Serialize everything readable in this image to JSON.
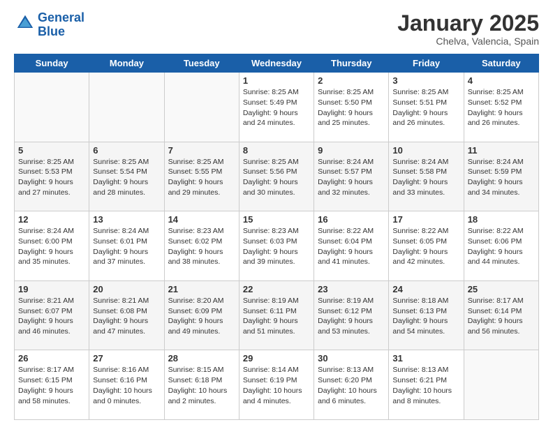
{
  "logo": {
    "line1": "General",
    "line2": "Blue"
  },
  "title": "January 2025",
  "location": "Chelva, Valencia, Spain",
  "weekdays": [
    "Sunday",
    "Monday",
    "Tuesday",
    "Wednesday",
    "Thursday",
    "Friday",
    "Saturday"
  ],
  "weeks": [
    [
      {
        "day": "",
        "sunrise": "",
        "sunset": "",
        "daylight": ""
      },
      {
        "day": "",
        "sunrise": "",
        "sunset": "",
        "daylight": ""
      },
      {
        "day": "",
        "sunrise": "",
        "sunset": "",
        "daylight": ""
      },
      {
        "day": "1",
        "sunrise": "Sunrise: 8:25 AM",
        "sunset": "Sunset: 5:49 PM",
        "daylight": "Daylight: 9 hours and 24 minutes."
      },
      {
        "day": "2",
        "sunrise": "Sunrise: 8:25 AM",
        "sunset": "Sunset: 5:50 PM",
        "daylight": "Daylight: 9 hours and 25 minutes."
      },
      {
        "day": "3",
        "sunrise": "Sunrise: 8:25 AM",
        "sunset": "Sunset: 5:51 PM",
        "daylight": "Daylight: 9 hours and 26 minutes."
      },
      {
        "day": "4",
        "sunrise": "Sunrise: 8:25 AM",
        "sunset": "Sunset: 5:52 PM",
        "daylight": "Daylight: 9 hours and 26 minutes."
      }
    ],
    [
      {
        "day": "5",
        "sunrise": "Sunrise: 8:25 AM",
        "sunset": "Sunset: 5:53 PM",
        "daylight": "Daylight: 9 hours and 27 minutes."
      },
      {
        "day": "6",
        "sunrise": "Sunrise: 8:25 AM",
        "sunset": "Sunset: 5:54 PM",
        "daylight": "Daylight: 9 hours and 28 minutes."
      },
      {
        "day": "7",
        "sunrise": "Sunrise: 8:25 AM",
        "sunset": "Sunset: 5:55 PM",
        "daylight": "Daylight: 9 hours and 29 minutes."
      },
      {
        "day": "8",
        "sunrise": "Sunrise: 8:25 AM",
        "sunset": "Sunset: 5:56 PM",
        "daylight": "Daylight: 9 hours and 30 minutes."
      },
      {
        "day": "9",
        "sunrise": "Sunrise: 8:24 AM",
        "sunset": "Sunset: 5:57 PM",
        "daylight": "Daylight: 9 hours and 32 minutes."
      },
      {
        "day": "10",
        "sunrise": "Sunrise: 8:24 AM",
        "sunset": "Sunset: 5:58 PM",
        "daylight": "Daylight: 9 hours and 33 minutes."
      },
      {
        "day": "11",
        "sunrise": "Sunrise: 8:24 AM",
        "sunset": "Sunset: 5:59 PM",
        "daylight": "Daylight: 9 hours and 34 minutes."
      }
    ],
    [
      {
        "day": "12",
        "sunrise": "Sunrise: 8:24 AM",
        "sunset": "Sunset: 6:00 PM",
        "daylight": "Daylight: 9 hours and 35 minutes."
      },
      {
        "day": "13",
        "sunrise": "Sunrise: 8:24 AM",
        "sunset": "Sunset: 6:01 PM",
        "daylight": "Daylight: 9 hours and 37 minutes."
      },
      {
        "day": "14",
        "sunrise": "Sunrise: 8:23 AM",
        "sunset": "Sunset: 6:02 PM",
        "daylight": "Daylight: 9 hours and 38 minutes."
      },
      {
        "day": "15",
        "sunrise": "Sunrise: 8:23 AM",
        "sunset": "Sunset: 6:03 PM",
        "daylight": "Daylight: 9 hours and 39 minutes."
      },
      {
        "day": "16",
        "sunrise": "Sunrise: 8:22 AM",
        "sunset": "Sunset: 6:04 PM",
        "daylight": "Daylight: 9 hours and 41 minutes."
      },
      {
        "day": "17",
        "sunrise": "Sunrise: 8:22 AM",
        "sunset": "Sunset: 6:05 PM",
        "daylight": "Daylight: 9 hours and 42 minutes."
      },
      {
        "day": "18",
        "sunrise": "Sunrise: 8:22 AM",
        "sunset": "Sunset: 6:06 PM",
        "daylight": "Daylight: 9 hours and 44 minutes."
      }
    ],
    [
      {
        "day": "19",
        "sunrise": "Sunrise: 8:21 AM",
        "sunset": "Sunset: 6:07 PM",
        "daylight": "Daylight: 9 hours and 46 minutes."
      },
      {
        "day": "20",
        "sunrise": "Sunrise: 8:21 AM",
        "sunset": "Sunset: 6:08 PM",
        "daylight": "Daylight: 9 hours and 47 minutes."
      },
      {
        "day": "21",
        "sunrise": "Sunrise: 8:20 AM",
        "sunset": "Sunset: 6:09 PM",
        "daylight": "Daylight: 9 hours and 49 minutes."
      },
      {
        "day": "22",
        "sunrise": "Sunrise: 8:19 AM",
        "sunset": "Sunset: 6:11 PM",
        "daylight": "Daylight: 9 hours and 51 minutes."
      },
      {
        "day": "23",
        "sunrise": "Sunrise: 8:19 AM",
        "sunset": "Sunset: 6:12 PM",
        "daylight": "Daylight: 9 hours and 53 minutes."
      },
      {
        "day": "24",
        "sunrise": "Sunrise: 8:18 AM",
        "sunset": "Sunset: 6:13 PM",
        "daylight": "Daylight: 9 hours and 54 minutes."
      },
      {
        "day": "25",
        "sunrise": "Sunrise: 8:17 AM",
        "sunset": "Sunset: 6:14 PM",
        "daylight": "Daylight: 9 hours and 56 minutes."
      }
    ],
    [
      {
        "day": "26",
        "sunrise": "Sunrise: 8:17 AM",
        "sunset": "Sunset: 6:15 PM",
        "daylight": "Daylight: 9 hours and 58 minutes."
      },
      {
        "day": "27",
        "sunrise": "Sunrise: 8:16 AM",
        "sunset": "Sunset: 6:16 PM",
        "daylight": "Daylight: 10 hours and 0 minutes."
      },
      {
        "day": "28",
        "sunrise": "Sunrise: 8:15 AM",
        "sunset": "Sunset: 6:18 PM",
        "daylight": "Daylight: 10 hours and 2 minutes."
      },
      {
        "day": "29",
        "sunrise": "Sunrise: 8:14 AM",
        "sunset": "Sunset: 6:19 PM",
        "daylight": "Daylight: 10 hours and 4 minutes."
      },
      {
        "day": "30",
        "sunrise": "Sunrise: 8:13 AM",
        "sunset": "Sunset: 6:20 PM",
        "daylight": "Daylight: 10 hours and 6 minutes."
      },
      {
        "day": "31",
        "sunrise": "Sunrise: 8:13 AM",
        "sunset": "Sunset: 6:21 PM",
        "daylight": "Daylight: 10 hours and 8 minutes."
      },
      {
        "day": "",
        "sunrise": "",
        "sunset": "",
        "daylight": ""
      }
    ]
  ]
}
